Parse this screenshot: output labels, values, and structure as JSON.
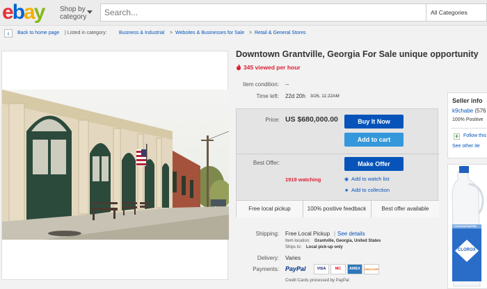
{
  "header": {
    "logo_letters": [
      "e",
      "b",
      "a",
      "y"
    ],
    "logo_colors": [
      "#e53238",
      "#0064d2",
      "#f5af02",
      "#86b817"
    ],
    "shop_by": "Shop by category",
    "search_placeholder": "Search...",
    "category_select": "All Categories"
  },
  "breadcrumb": {
    "back": "Back to home page",
    "listed_in": "| Listed in category:",
    "items": [
      "Business & Industrial",
      "Websites & Businesses for Sale",
      "Retail & General Stores"
    ],
    "separator": ">"
  },
  "listing": {
    "title": "Downtown Grantville, Georgia For Sale unique opportunity",
    "viewed": "345 viewed per hour",
    "item_condition_label": "Item condition:",
    "item_condition_value": "--",
    "time_left_label": "Time left:",
    "time_left_value": "22d 20h",
    "time_left_date": "3/26, 11:22AM"
  },
  "pricebox": {
    "price_label": "Price:",
    "price_value": "US $680,000.00",
    "buy_it_now": "Buy It Now",
    "add_to_cart": "Add to cart",
    "best_offer_label": "Best Offer:",
    "make_offer": "Make Offer",
    "watching": "1919 watching",
    "add_to_watch_list": "Add to watch list",
    "add_to_collection": "Add to collection",
    "features": [
      "Free local pickup",
      "100% positive feedback",
      "Best offer available"
    ]
  },
  "shipping": {
    "shipping_label": "Shipping:",
    "shipping_value": "Free Local Pickup",
    "see_details": "See details",
    "item_location": "Item location:",
    "item_location_value": "Grantville, Georgia, United States",
    "ships_to": "Ships to:",
    "ships_to_value": "Local pick-up only",
    "delivery_label": "Delivery:",
    "delivery_value": "Varies",
    "payments_label": "Payments:",
    "paypal": "PayPal",
    "cards": [
      "VISA",
      "MC",
      "AMEX",
      "DISCOVER"
    ],
    "credit_note": "Credit Cards processed by PayPal"
  },
  "seller": {
    "title": "Seller info",
    "name": "k9chabe",
    "name_suffix": "(576",
    "positive": "100% Positive",
    "follow": "Follow this",
    "other_items": "See other ite"
  },
  "ad": {
    "brand": "CLOROX",
    "concentrated": "CONCENTRATED"
  }
}
